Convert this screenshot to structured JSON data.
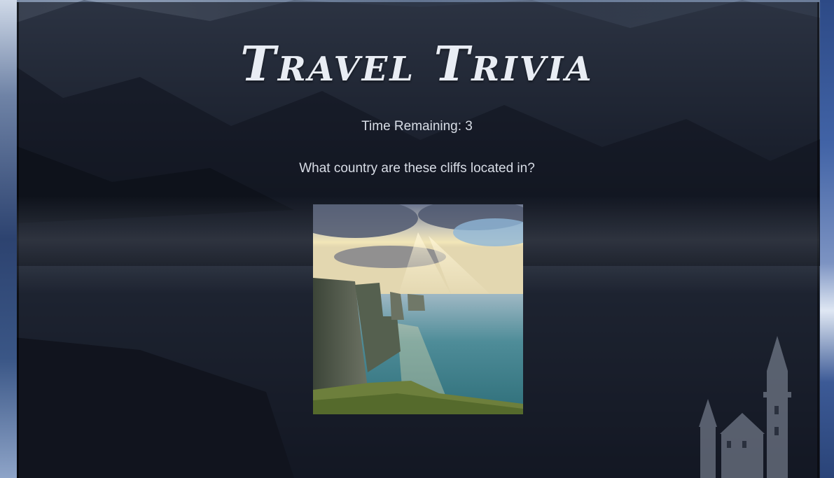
{
  "header": {
    "title": "Travel Trivia"
  },
  "game": {
    "timer_text": "Time Remaining: 3",
    "question": "What country are these cliffs located in?"
  },
  "image": {
    "subject": "sea cliffs with sunbeams over the ocean"
  },
  "colors": {
    "panel": "#0e121c",
    "text": "#d8dde6",
    "title": "#e9edf4"
  }
}
